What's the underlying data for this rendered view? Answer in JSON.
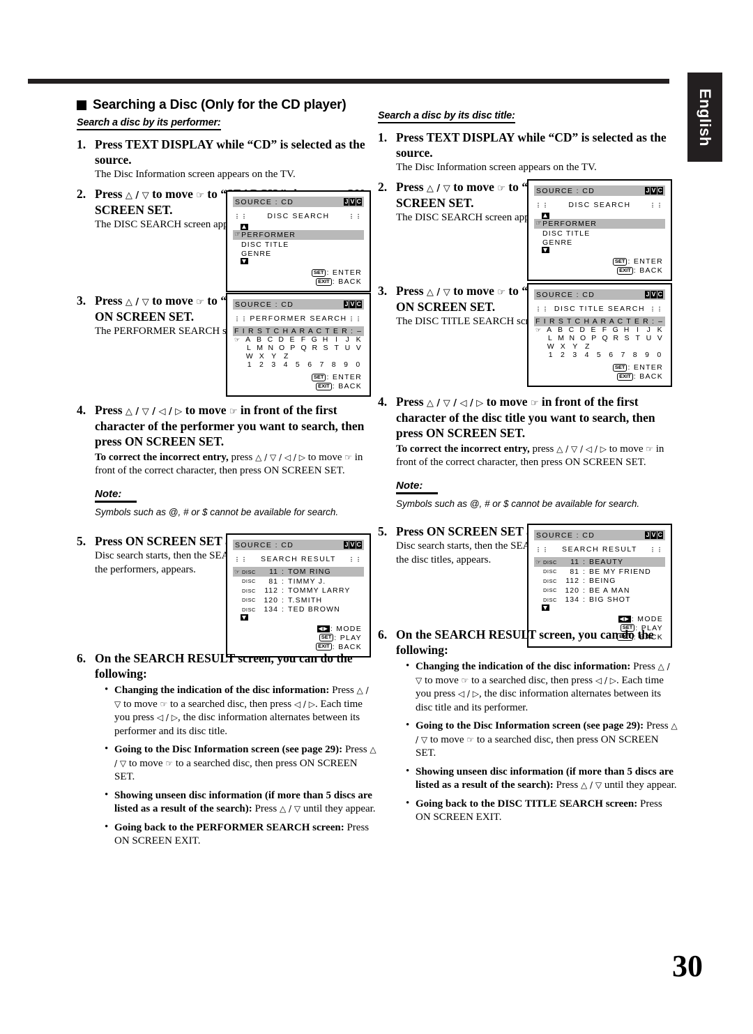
{
  "page": {
    "language_tab": "English",
    "page_number": "30"
  },
  "section": {
    "heading": "Searching a Disc (Only for the CD player)"
  },
  "left": {
    "subheading": "Search a disc by its performer:",
    "steps": [
      {
        "num": "1.",
        "title": "Press TEXT DISPLAY while “CD” is selected as the source.",
        "sub": "The Disc Information screen appears on the TV."
      },
      {
        "num": "2.",
        "title_a": "Press ",
        "title_b": " to move ",
        "title_c": "to “SEARCH,” then press ON SCREEN SET.",
        "sub": "The DISC SEARCH screen appears."
      },
      {
        "num": "3.",
        "title_c": "to “PERFORMER”, then press ON SCREEN SET.",
        "sub": "The PERFORMER SEARCH screen appears."
      },
      {
        "num": "4.",
        "title_a": "Press ",
        "title_b": " to move ",
        "title_c": " in front of the first character of the performer you want to search, then press ON SCREEN SET.",
        "correct_bold": "To correct the incorrect entry,",
        "correct_rest_a": " press ",
        "correct_rest_b": " to move ",
        "correct_rest_c": " in front of the correct character, then press ON SCREEN SET.",
        "note_label": "Note:",
        "note_text": "Symbols such as @, # or $ cannot be available for search."
      },
      {
        "num": "5.",
        "title": "Press ON SCREEN SET again.",
        "sub": "Disc search starts, then the SEARCH RESULT screen, showing the performers, appears."
      },
      {
        "num": "6.",
        "title": "On the SEARCH RESULT screen, you can do the following:",
        "bullets": [
          {
            "bold": "Changing the indication of the disc information:",
            "rest_a": " Press ",
            "rest_b": " to move ",
            "rest_c": " to a searched disc, then press ",
            "rest_d": ". Each time you press ",
            "rest_e": ", the disc information alternates between its performer and its disc title."
          },
          {
            "bold": "Going to the Disc Information screen (see page 29):",
            "rest_a": " Press ",
            "rest_b": " to move ",
            "rest_c": " to a searched disc, then press ON SCREEN SET."
          },
          {
            "bold": "Showing unseen disc information (if more than 5 discs are listed as a result of the search):",
            "rest_a": " Press ",
            "rest_b": " until they appear."
          },
          {
            "bold": "Going back to the PERFORMER SEARCH screen:",
            "rest_a": " Press ON SCREEN EXIT."
          }
        ]
      }
    ]
  },
  "right": {
    "subheading": "Search a disc by its disc title:",
    "steps": [
      {
        "num": "1.",
        "title": "Press TEXT DISPLAY while “CD” is selected as the source.",
        "sub": "The Disc Information screen appears on the TV."
      },
      {
        "num": "2.",
        "title_c": "to “SEARCH,” then press ON SCREEN SET.",
        "sub": "The DISC SEARCH screen appears."
      },
      {
        "num": "3.",
        "title_c": "to “DISC TITLE”, then press ON SCREEN SET.",
        "sub": "The DISC TITLE SEARCH screen appears."
      },
      {
        "num": "4.",
        "title_c": " in front of the first character of the disc title you want to search, then press ON SCREEN SET.",
        "correct_bold": "To correct the incorrect entry,",
        "correct_rest_c": " in front of the correct character, then press ON SCREEN SET.",
        "note_label": "Note:",
        "note_text": "Symbols such as @, # or $ cannot be available for search."
      },
      {
        "num": "5.",
        "title": "Press ON SCREEN SET again.",
        "sub": "Disc search starts, then the SEARCH RESULT screen, showing the disc titles, appears."
      },
      {
        "num": "6.",
        "title": "On the SEARCH RESULT screen, you can do the following:",
        "bullets": [
          {
            "bold": "Changing the indication of the disc information:",
            "rest_e": ", the disc information alternates between its disc title and its performer."
          },
          {
            "bold": "Going to the Disc Information screen (see page 29):",
            "rest_c": " to a searched disc, then press ON SCREEN SET."
          },
          {
            "bold": "Showing unseen disc information (if more than 5 discs are listed as a result of the search):",
            "rest_b": " until they appear."
          },
          {
            "bold": "Going back to the DISC TITLE SEARCH screen:",
            "rest_a": " Press ON SCREEN EXIT."
          }
        ]
      }
    ]
  },
  "osd": {
    "brand": "JVC",
    "source_label": "SOURCE :  CD",
    "marks": "¨",
    "disc_search": {
      "title": "DISC SEARCH",
      "items": [
        "PERFORMER",
        "DISC TITLE",
        "GENRE"
      ],
      "selected": "PERFORMER",
      "keys": [
        {
          "key": "SET",
          "action": ": ENTER"
        },
        {
          "key": "EXIT",
          "action": ": BACK"
        }
      ]
    },
    "performer_search": {
      "title": "PERFORMER SEARCH",
      "field_label": "F I R S T   C H A R A C T E R :",
      "field_value": "–",
      "alpha_rows": [
        [
          "A",
          "B",
          "C",
          "D",
          "E",
          "F",
          "G",
          "H",
          "I",
          "J",
          "K"
        ],
        [
          "L",
          "M",
          "N",
          "O",
          "P",
          "Q",
          "R",
          "S",
          "T",
          "U",
          "V"
        ],
        [
          "W",
          "X",
          "Y",
          "Z"
        ],
        [
          "1",
          "2",
          "3",
          "4",
          "5",
          "6",
          "7",
          "8",
          "9",
          "0"
        ]
      ],
      "keys": [
        {
          "key": "SET",
          "action": ": ENTER"
        },
        {
          "key": "EXIT",
          "action": ": BACK"
        }
      ]
    },
    "disc_title_search": {
      "title": "DISC TITLE SEARCH",
      "field_label": "F I R S T   C H A R A C T E R :",
      "field_value": "–",
      "alpha_rows": [
        [
          "A",
          "B",
          "C",
          "D",
          "E",
          "F",
          "G",
          "H",
          "I",
          "J",
          "K"
        ],
        [
          "L",
          "M",
          "N",
          "O",
          "P",
          "Q",
          "R",
          "S",
          "T",
          "U",
          "V"
        ],
        [
          "W",
          "X",
          "Y",
          "Z"
        ],
        [
          "1",
          "2",
          "3",
          "4",
          "5",
          "6",
          "7",
          "8",
          "9",
          "0"
        ]
      ],
      "keys": [
        {
          "key": "SET",
          "action": ": ENTER"
        },
        {
          "key": "EXIT",
          "action": ": BACK"
        }
      ]
    },
    "search_result_performer": {
      "title": "SEARCH RESULT",
      "disc_label": "DISC",
      "rows": [
        {
          "disc": "11",
          "name": "TOM RING"
        },
        {
          "disc": "81",
          "name": "TIMMY J."
        },
        {
          "disc": "112",
          "name": "TOMMY LARRY"
        },
        {
          "disc": "120",
          "name": "T.SMITH"
        },
        {
          "disc": "134",
          "name": "TED BROWN"
        }
      ],
      "keys": [
        {
          "key": "◀▶",
          "action": ": MODE"
        },
        {
          "key": "SET",
          "action": ": PLAY"
        },
        {
          "key": "EXIT",
          "action": ": BACK"
        }
      ]
    },
    "search_result_title": {
      "title": "SEARCH RESULT",
      "disc_label": "DISC",
      "rows": [
        {
          "disc": "11",
          "name": "BEAUTY"
        },
        {
          "disc": "81",
          "name": "BE MY FRIEND"
        },
        {
          "disc": "112",
          "name": "BEING"
        },
        {
          "disc": "120",
          "name": "BE A MAN"
        },
        {
          "disc": "134",
          "name": "BIG SHOT"
        }
      ],
      "keys": [
        {
          "key": "◀▶",
          "action": ": MODE"
        },
        {
          "key": "SET",
          "action": ": PLAY"
        },
        {
          "key": "EXIT",
          "action": ": BACK"
        }
      ]
    }
  },
  "glyphs": {
    "up": "△",
    "down": "▽",
    "left": "◁",
    "right": "▷",
    "hand": "☞",
    "ud": "△ / ▽",
    "udlr": "△ / ▽ / ◁ / ▷",
    "lr": "◁ / ▷"
  }
}
